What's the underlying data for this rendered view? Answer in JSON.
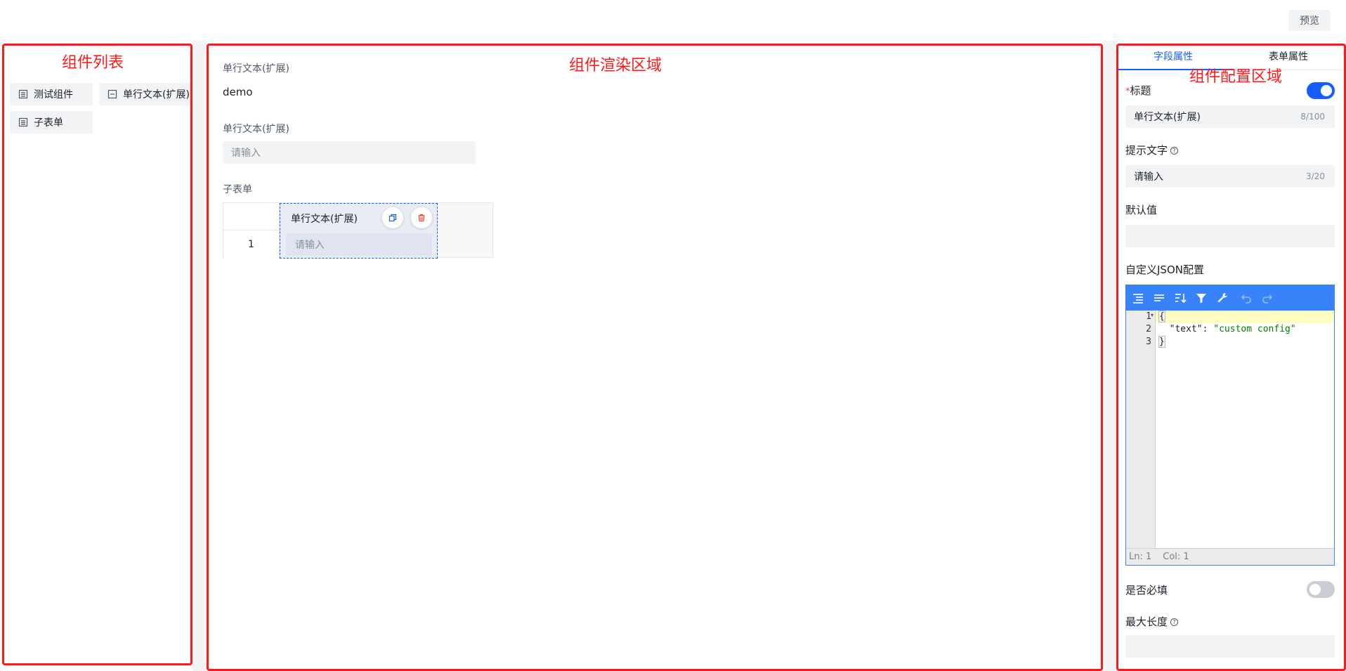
{
  "header": {
    "preview_label": "预览"
  },
  "component_list": {
    "items": [
      {
        "label": "测试组件",
        "icon": "list-doc-icon"
      },
      {
        "label": "单行文本(扩展)",
        "icon": "text-input-icon"
      },
      {
        "label": "子表单",
        "icon": "list-doc-icon"
      }
    ]
  },
  "canvas": {
    "field1": {
      "label": "单行文本(扩展)",
      "value": "demo"
    },
    "field2": {
      "label": "单行文本(扩展)",
      "placeholder": "请输入"
    },
    "subform": {
      "label": "子表单",
      "column_header": "单行文本(扩展)",
      "row_index": "1",
      "cell_placeholder": "请输入"
    }
  },
  "config": {
    "tabs": [
      {
        "label": "字段属性",
        "active": true
      },
      {
        "label": "表单属性",
        "active": false
      }
    ],
    "title_label": "标题",
    "required_mark": "*",
    "title_toggle_on": true,
    "title_value": "单行文本(扩展)",
    "title_count": "8/100",
    "placeholder_label": "提示文字",
    "placeholder_value": "请输入",
    "placeholder_count": "3/20",
    "default_label": "默认值",
    "json_label": "自定义JSON配置",
    "json_editor": {
      "lines": [
        "1",
        "2",
        "3"
      ],
      "code_open": "{",
      "code_key": "\"text\"",
      "code_colon": ": ",
      "code_value": "\"custom config\"",
      "code_close": "}",
      "status_ln": "Ln: 1",
      "status_col": "Col: 1"
    },
    "required_label": "是否必填",
    "required_toggle_on": false,
    "maxlen_label": "最大长度"
  },
  "annotations": {
    "left": "组件列表",
    "center": "组件渲染区域",
    "right": "组件配置区域"
  },
  "colors": {
    "accent": "#165dff",
    "annotation": "#ff1a1a",
    "editor_toolbar": "#3883fa",
    "danger": "#f53f3f"
  }
}
